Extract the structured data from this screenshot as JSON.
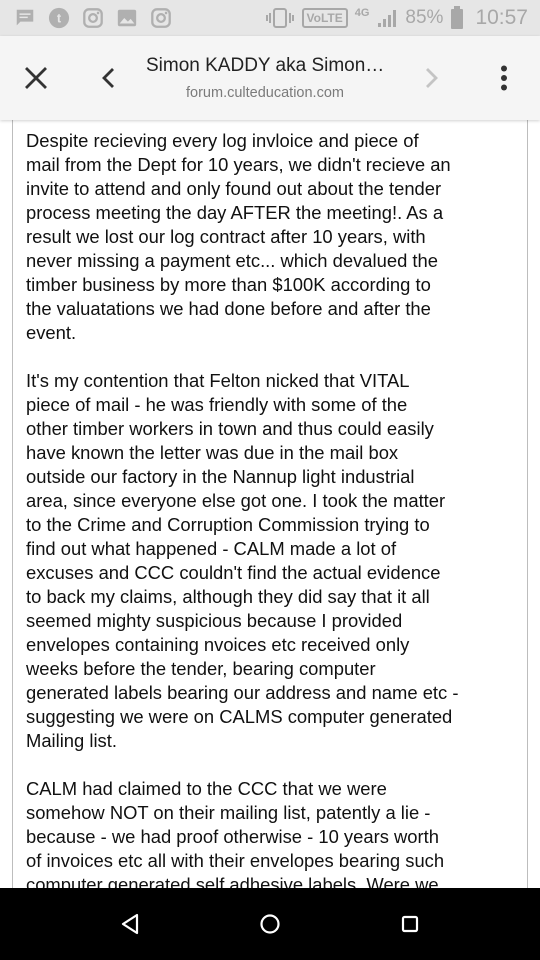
{
  "status_bar": {
    "volte": "VoLTE",
    "network": "4G",
    "battery": "85%",
    "time": "10:57",
    "left_icons": [
      "chat-icon",
      "tumblr-icon",
      "instagram-icon",
      "image-icon",
      "instagram-icon"
    ],
    "right_icons": [
      "vibrate-icon",
      "signal-icon",
      "battery-icon"
    ]
  },
  "toolbar": {
    "title": "Simon KADDY aka Simon…",
    "url": "forum.culteducation.com",
    "icons": [
      "close-icon",
      "back-arrow-icon",
      "forward-arrow-icon",
      "overflow-menu-icon"
    ]
  },
  "post": {
    "paragraphs": [
      "Despite recieving every log invloice and piece of\nmail from the Dept for 10 years, we didn't recieve an\ninvite to attend and only found out about the tender\nprocess meeting the day AFTER the meeting!. As a\nresult we lost our log contract after 10 years, with\nnever missing a payment etc... which devalued the\ntimber business by more than $100K according to\nthe valuatations we had done before and after the\nevent.",
      "It's my contention that Felton nicked that VITAL\npiece of mail - he was friendly with some of the\nother timber workers in town and thus could easily\nhave known the letter was due in the mail box\noutside our factory in the Nannup light industrial\narea, since everyone else got one. I took the matter\nto the Crime and Corruption Commission trying to\nfind out what happened - CALM made a lot of\nexcuses and CCC couldn't find the actual evidence\nto back my claims, although they did say that it all\nseemed mighty suspicious because I provided\nenvelopes containing nvoices etc received only\nweeks before the tender, bearing computer\ngenerated labels bearing our address and name etc -\nsuggesting we were on CALMS computer generated\nMailing list.",
      "CALM had claimed to the CCC that we were\nsomehow NOT on their mailing list, patently a lie -\nbecause - we had proof otherwise - 10 years worth\nof invoices etc all with their envelopes bearing such\ncomputer generated self adhesive labels. Were we"
    ]
  },
  "nav_bar": {
    "icons": [
      "nav-back-icon",
      "nav-home-icon",
      "nav-recents-icon"
    ]
  }
}
